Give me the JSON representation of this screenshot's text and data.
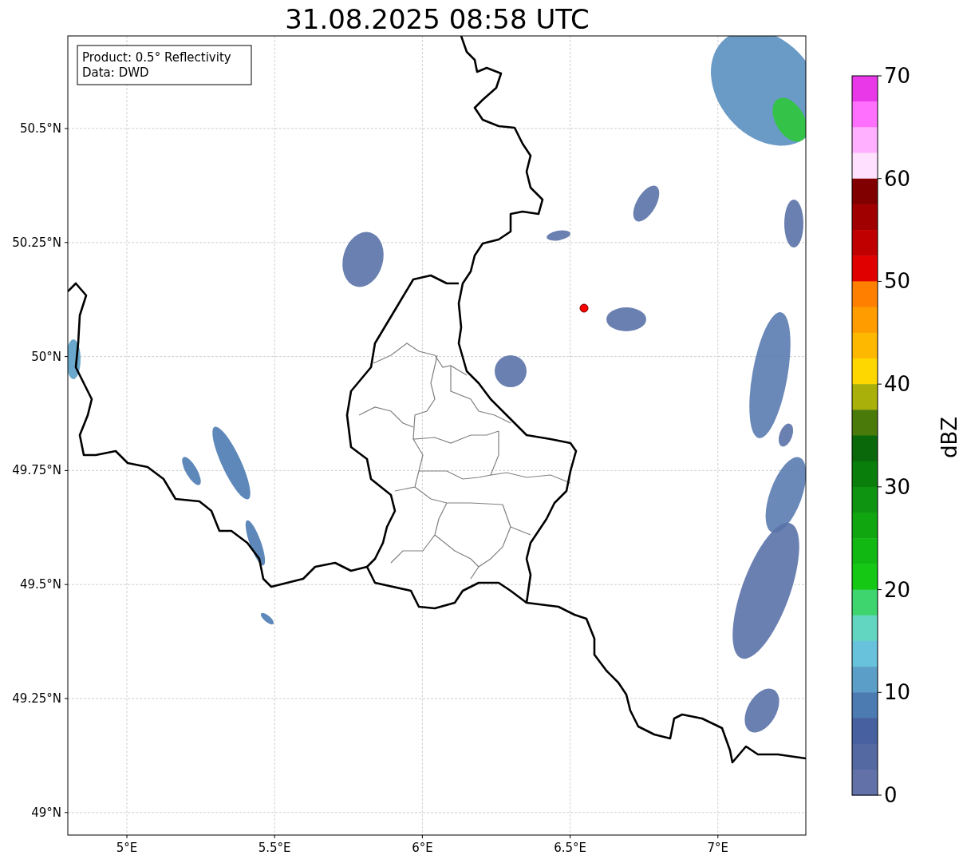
{
  "title": "31.08.2025 08:58 UTC",
  "info_box": [
    "Product: 0.5° Reflectivity",
    "Data: DWD"
  ],
  "lat_labels": [
    "50.5°N",
    "50.25°N",
    "50°N",
    "49.75°N",
    "49.5°N",
    "49.25°N",
    "49°N"
  ],
  "lon_labels": [
    "5°E",
    "5.5°E",
    "6°E",
    "6.5°E",
    "7°E"
  ],
  "colorbar": {
    "label": "dBZ",
    "ticks": [
      "70",
      "60",
      "50",
      "40",
      "30",
      "20",
      "10",
      "0"
    ],
    "segments": [
      {
        "color": "#e838e8"
      },
      {
        "color": "#ff70ff"
      },
      {
        "color": "#ffb0ff"
      },
      {
        "color": "#ffe0ff"
      },
      {
        "color": "#800000"
      },
      {
        "color": "#a00000"
      },
      {
        "color": "#c00000"
      },
      {
        "color": "#e00000"
      },
      {
        "color": "#ff8000"
      },
      {
        "color": "#ff9c00"
      },
      {
        "color": "#ffb800"
      },
      {
        "color": "#ffd700"
      },
      {
        "color": "#aab00a"
      },
      {
        "color": "#4a7a0a"
      },
      {
        "color": "#0a680a"
      },
      {
        "color": "#0a7e0a"
      },
      {
        "color": "#0e9410"
      },
      {
        "color": "#10a610"
      },
      {
        "color": "#12b812"
      },
      {
        "color": "#14c814"
      },
      {
        "color": "#3ed46e"
      },
      {
        "color": "#63d6c2"
      },
      {
        "color": "#69c2dc"
      },
      {
        "color": "#5b9fc8"
      },
      {
        "color": "#4b7bb1"
      },
      {
        "color": "#4660a0"
      },
      {
        "color": "#5468a2"
      },
      {
        "color": "#6272a8"
      }
    ]
  }
}
